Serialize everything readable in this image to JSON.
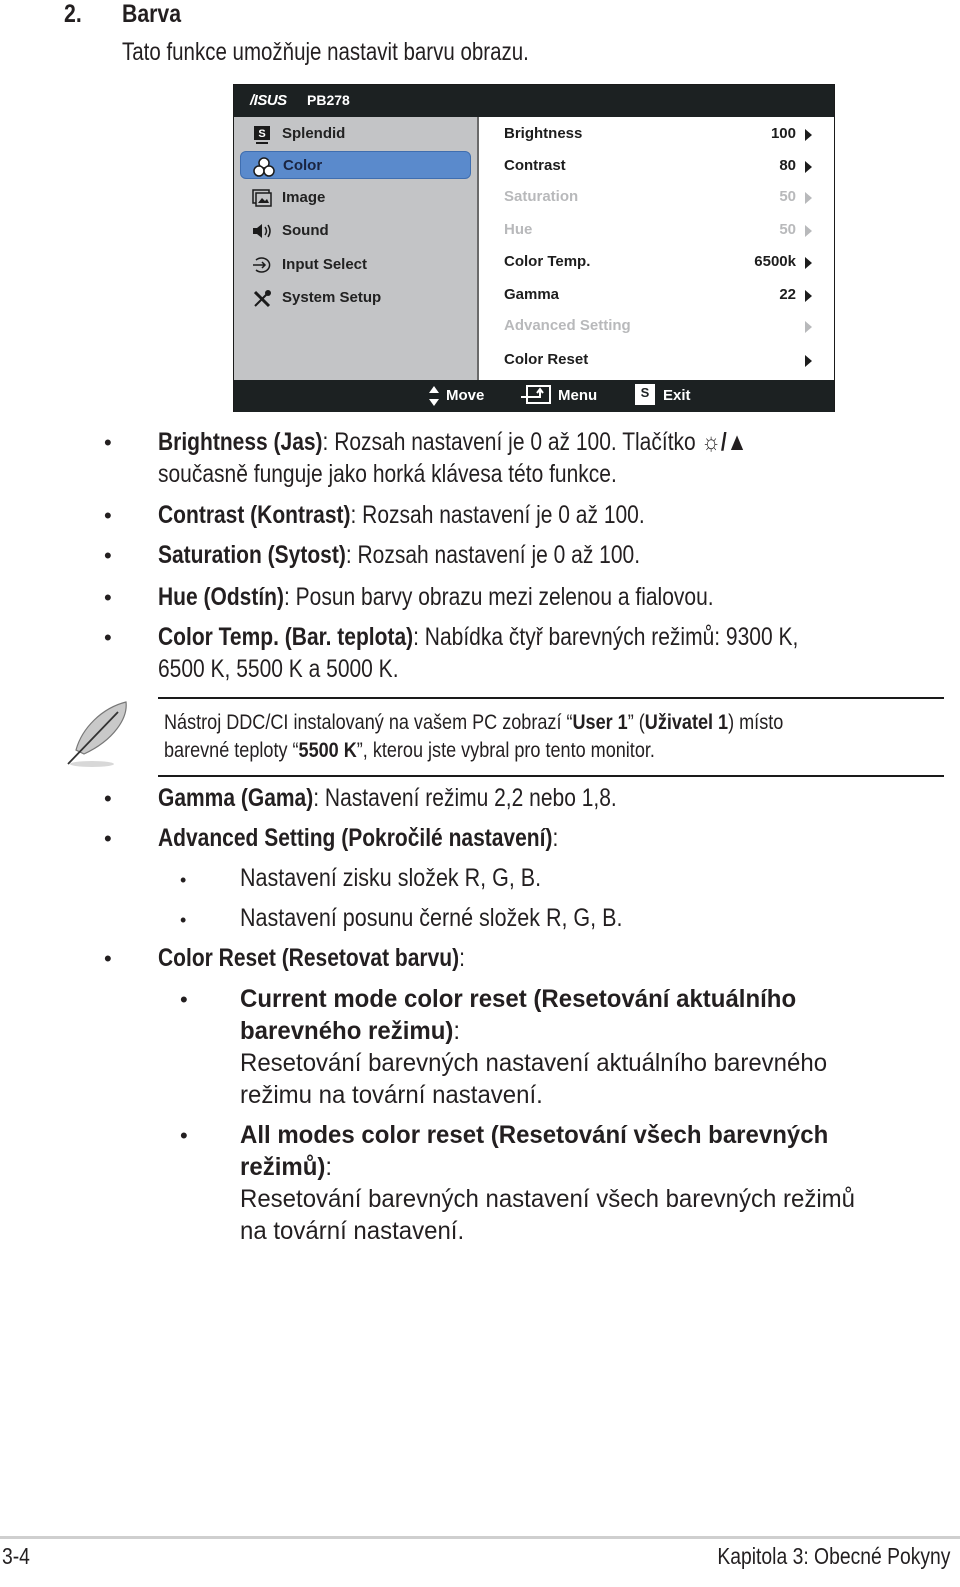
{
  "heading": {
    "number": "2.",
    "title": "Barva",
    "intro": "Tato funkce umožňuje nastavit barvu obrazu."
  },
  "osd": {
    "brand": "/ISUS",
    "model": "PB278",
    "nav": [
      {
        "label": "Splendid",
        "icon": "splendid-icon",
        "active": false
      },
      {
        "label": "Color",
        "icon": "color-rgb-icon",
        "active": true
      },
      {
        "label": "Image",
        "icon": "image-icon",
        "active": false
      },
      {
        "label": "Sound",
        "icon": "speaker-icon",
        "active": false
      },
      {
        "label": "Input Select",
        "icon": "input-select-icon",
        "active": false
      },
      {
        "label": "System Setup",
        "icon": "tools-icon",
        "active": false
      }
    ],
    "settings": [
      {
        "label": "Brightness",
        "value": "100",
        "enabled": true
      },
      {
        "label": "Contrast",
        "value": "80",
        "enabled": true
      },
      {
        "label": "Saturation",
        "value": "50",
        "enabled": false
      },
      {
        "label": "Hue",
        "value": "50",
        "enabled": false
      },
      {
        "label": "Color Temp.",
        "value": "6500k",
        "enabled": true
      },
      {
        "label": "Gamma",
        "value": "22",
        "enabled": true
      },
      {
        "label": "Advanced Setting",
        "value": "",
        "enabled": false
      },
      {
        "label": "Color Reset",
        "value": "",
        "enabled": true
      }
    ],
    "footer": {
      "move": "Move",
      "menu": "Menu",
      "exit": "Exit",
      "exit_key": "S"
    }
  },
  "items": {
    "brightness": {
      "term": "Brightness (Jas)",
      "desc": ": Rozsah nastavení je 0 až 100. Tlačítko",
      "line2": "současně funguje jako horká klávesa této funkce."
    },
    "contrast": {
      "term": "Contrast (Kontrast)",
      "desc": ": Rozsah nastavení je 0 až 100."
    },
    "saturation": {
      "term": "Saturation (Sytost)",
      "desc": ": Rozsah nastavení je 0 až 100."
    },
    "hue": {
      "term": "Hue (Odstín)",
      "desc": ": Posun barvy obrazu mezi zelenou a fialovou."
    },
    "colortemp": {
      "term": "Color Temp. (Bar. teplota)",
      "desc": ": Nabídka čtyř barevných režimů: 9300 K,",
      "line2": "6500 K, 5500 K a 5000 K."
    },
    "note": {
      "p1": "Nástroj DDC/CI instalovaný na vašem PC zobrazí “",
      "b1": "User 1",
      "p2": "” (",
      "b2": "Uživatel 1",
      "p3": ") místo",
      "p4": "barevné teploty “",
      "b3": "5500 K",
      "p5": "”, kterou jste vybral pro tento monitor."
    },
    "gamma": {
      "term": "Gamma (Gama)",
      "desc": ": Nastavení režimu 2,2 nebo 1,8."
    },
    "advanced": {
      "term": "Advanced Setting (Pokročilé nastavení)",
      "desc": ":",
      "sub": [
        "Nastavení zisku složek R, G, B.",
        "Nastavení posunu černé složek R, G, B."
      ]
    },
    "reset": {
      "term": "Color Reset (Resetovat barvu)",
      "desc": ":",
      "sub": [
        {
          "title1": "Current mode color reset (Resetování aktuálního",
          "title2": "barevného režimu)",
          "desc1": "Resetování barevných nastavení aktuálního barevného",
          "desc2": "režimu na tovární nastavení."
        },
        {
          "title1": "All modes color reset (Resetování všech barevných",
          "title2": "režimů)",
          "desc1": "Resetování barevných nastavení všech barevných režimů",
          "desc2": "na tovární nastavení."
        }
      ]
    }
  },
  "footer": {
    "page": "3-4",
    "chapter": "Kapitola 3: Obecné Pokyny"
  }
}
